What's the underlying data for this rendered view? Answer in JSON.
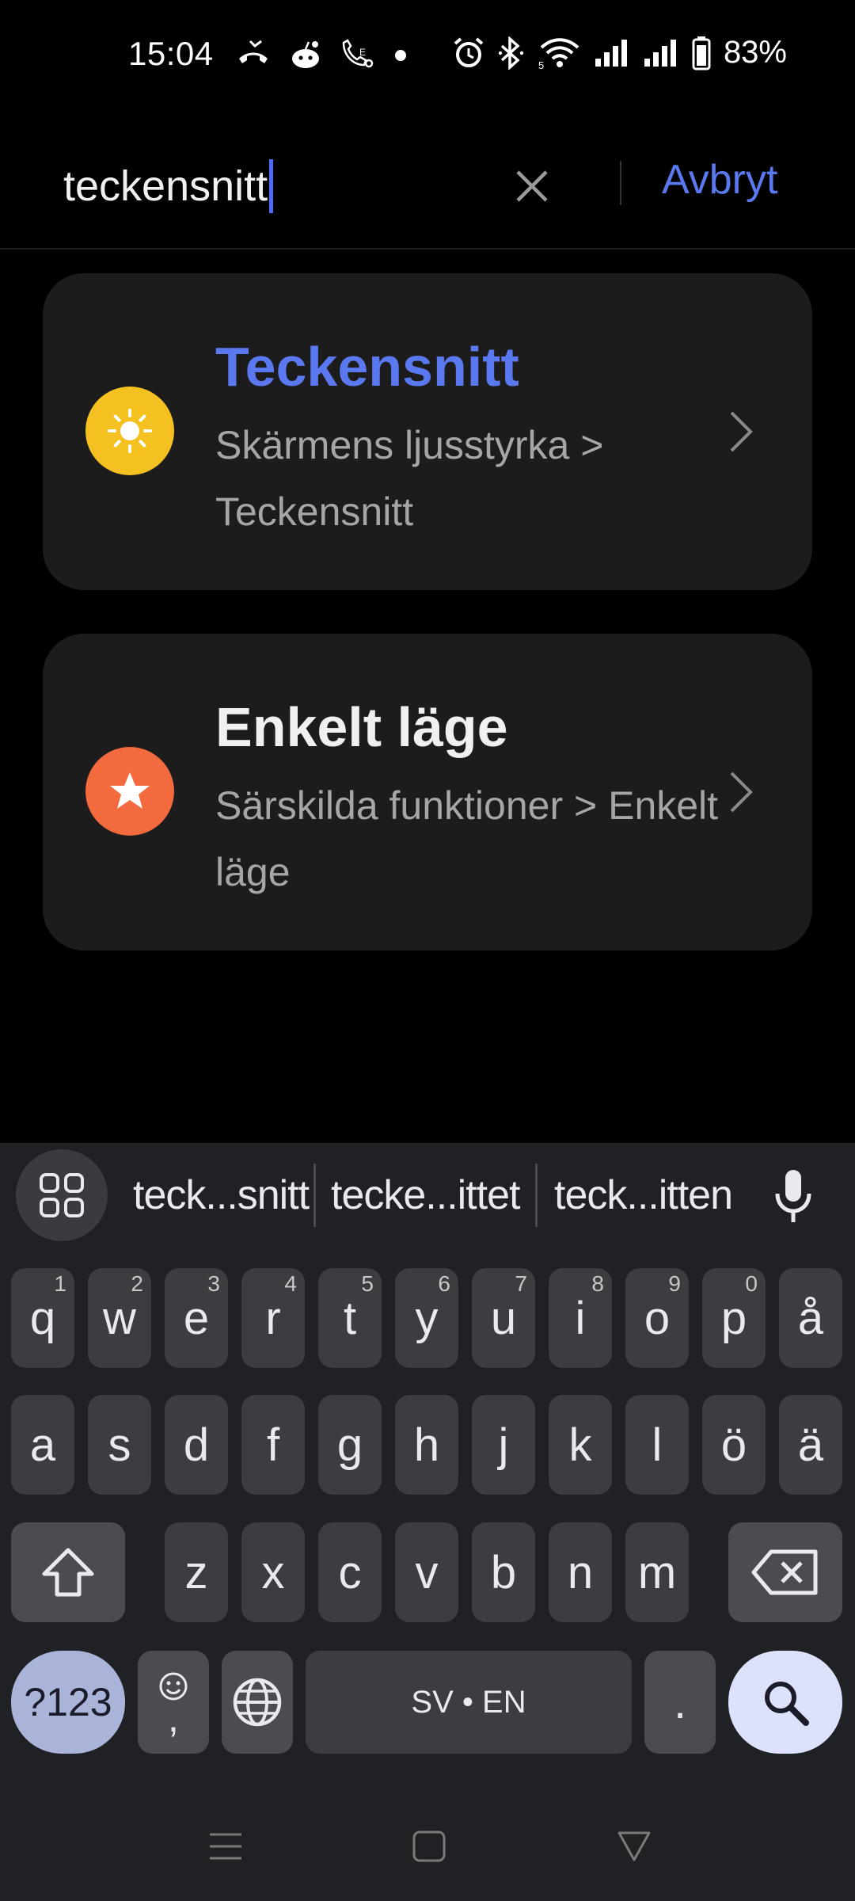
{
  "status_bar": {
    "time": "15:04",
    "left_icons": [
      "missed-call-icon",
      "reddit-icon",
      "wifi-calling-icon",
      "dot-icon"
    ],
    "right_icons": [
      "alarm-icon",
      "bluetooth-icon",
      "wifi-icon",
      "signal-icon",
      "signal-icon",
      "battery-icon"
    ],
    "battery_percent": "83%"
  },
  "search": {
    "value": "teckensnitt",
    "cancel_label": "Avbryt",
    "accent_color": "#5a78f0"
  },
  "results": [
    {
      "title": "Teckensnitt",
      "path": "Skärmens ljusstyrka > Teckensnitt",
      "icon": "brightness-icon",
      "icon_color": "#f5c120",
      "title_color": "#5a78f0"
    },
    {
      "title": "Enkelt läge",
      "path": "Särskilda funktioner > Enkelt läge",
      "icon": "star-icon",
      "icon_color": "#f26a3d",
      "title_color": "#f0f0f0"
    }
  ],
  "keyboard": {
    "suggestions": [
      "teck...snitt",
      "tecke...ittet",
      "teck...itten"
    ],
    "row1": [
      "q",
      "w",
      "e",
      "r",
      "t",
      "y",
      "u",
      "i",
      "o",
      "p",
      "å"
    ],
    "row1_hints": [
      "1",
      "2",
      "3",
      "4",
      "5",
      "6",
      "7",
      "8",
      "9",
      "0",
      ""
    ],
    "row2": [
      "a",
      "s",
      "d",
      "f",
      "g",
      "h",
      "j",
      "k",
      "l",
      "ö",
      "ä"
    ],
    "row3": [
      "z",
      "x",
      "c",
      "v",
      "b",
      "n",
      "m"
    ],
    "symbols_label": "?123",
    "comma_label": ",",
    "space_label": "SV • EN",
    "period_label": "."
  },
  "nav_bar": {
    "icons": [
      "recents-icon",
      "home-icon",
      "back-icon"
    ]
  }
}
